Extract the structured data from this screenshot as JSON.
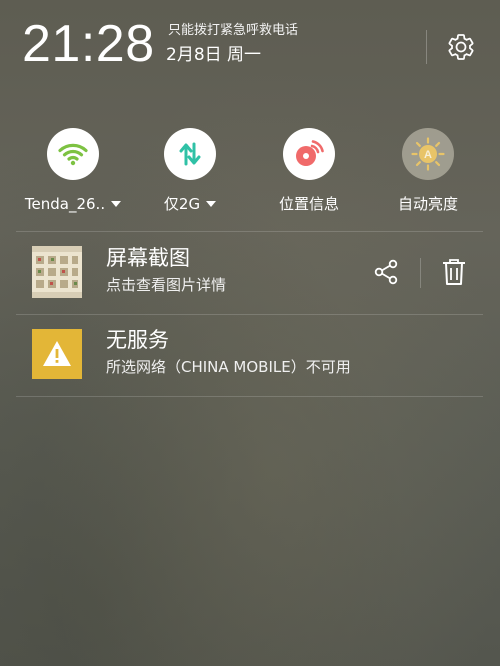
{
  "status": {
    "time": "21:28",
    "carrier_text": "只能拨打紧急呼救电话",
    "date": "2月8日 周一"
  },
  "quick_toggles": [
    {
      "label": "Tenda_26..",
      "icon": "wifi-icon",
      "state": "on",
      "color": "#7dc242",
      "has_dropdown": true
    },
    {
      "label": "仅2G",
      "icon": "mobile-data-icon",
      "state": "on",
      "color": "#2fc1a6",
      "has_dropdown": true
    },
    {
      "label": "位置信息",
      "icon": "location-icon",
      "state": "on",
      "color": "#f06a6a",
      "has_dropdown": false
    },
    {
      "label": "自动亮度",
      "icon": "auto-brightness-icon",
      "state": "off",
      "color": "#e8c468",
      "has_dropdown": false
    }
  ],
  "notifications": [
    {
      "title": "屏幕截图",
      "subtitle": "点击查看图片详情",
      "icon": "screenshot-thumbnail",
      "actions": [
        "share-icon",
        "trash-icon"
      ]
    },
    {
      "title": "无服务",
      "subtitle": "所选网络（CHINA MOBILE）不可用",
      "icon": "warning-icon",
      "icon_color": "#e3b637"
    }
  ]
}
